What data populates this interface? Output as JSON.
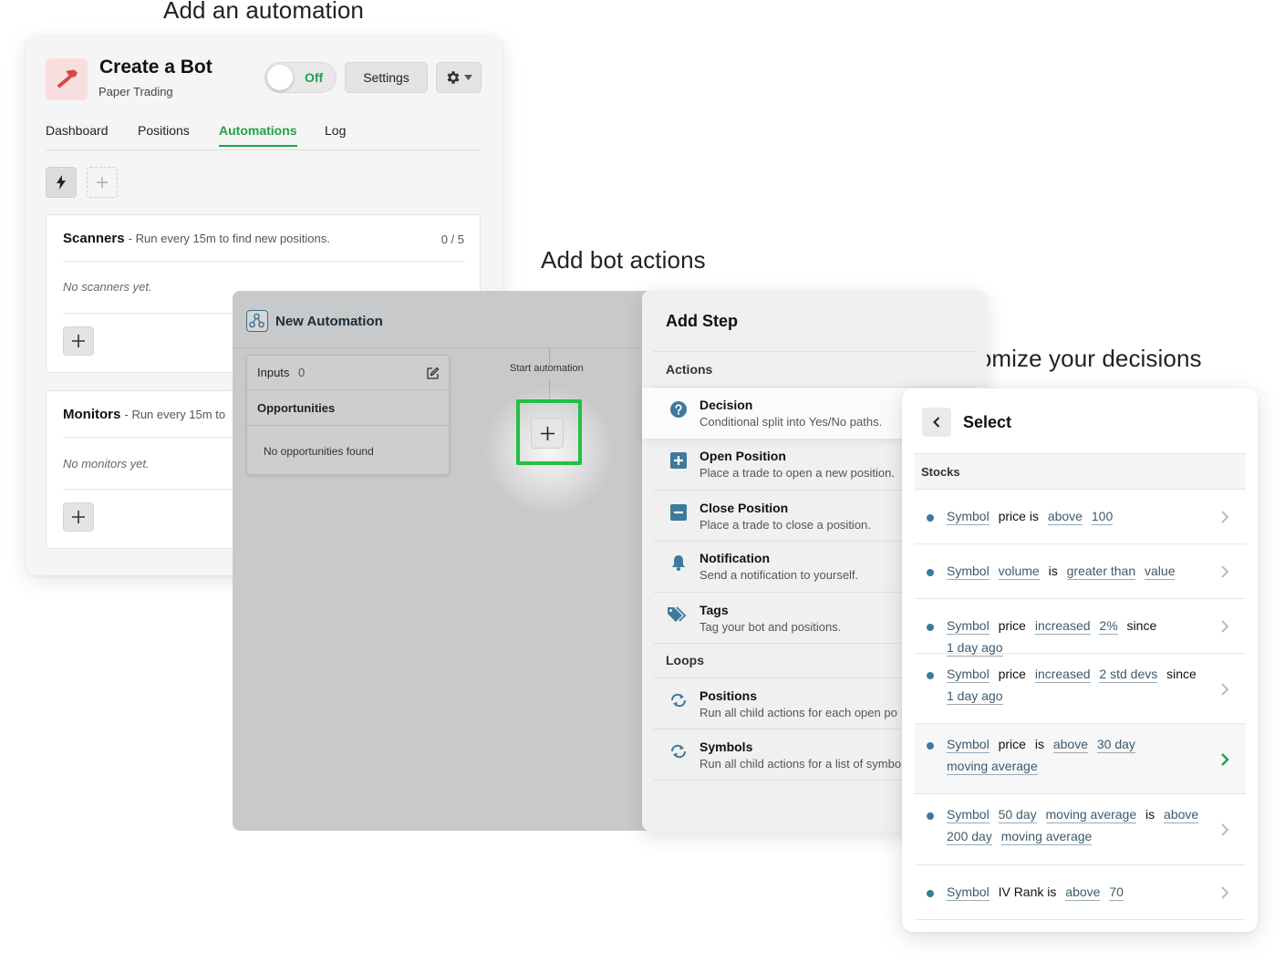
{
  "headings": {
    "automation": "Add an automation",
    "actions": "Add bot actions",
    "decisions": "Customize your decisions"
  },
  "bot": {
    "title": "Create a Bot",
    "subtitle": "Paper Trading",
    "toggle_label": "Off",
    "settings_label": "Settings",
    "tabs": [
      "Dashboard",
      "Positions",
      "Automations",
      "Log"
    ],
    "active_tab": "Automations",
    "scanners": {
      "title": "Scanners",
      "description": "- Run every 15m to find new positions.",
      "count": "0 / 5",
      "empty": "No scanners yet."
    },
    "monitors": {
      "title": "Monitors",
      "description": "- Run every 15m to",
      "empty": "No monitors yet."
    }
  },
  "automation": {
    "title": "New Automation",
    "inputs_label": "Inputs",
    "inputs_count": "0",
    "opportunities_label": "Opportunities",
    "opportunities_empty": "No opportunities found",
    "start_label": "Start automation"
  },
  "add_step": {
    "title": "Add Step",
    "actions_label": "Actions",
    "loops_label": "Loops",
    "actions": [
      {
        "name": "Decision",
        "desc": "Conditional split into Yes/No paths.",
        "icon": "question-circle-icon"
      },
      {
        "name": "Open Position",
        "desc": "Place a trade to open a new position.",
        "icon": "plus-square-icon"
      },
      {
        "name": "Close Position",
        "desc": "Place a trade to close a position.",
        "icon": "minus-square-icon"
      },
      {
        "name": "Notification",
        "desc": "Send a notification to yourself.",
        "icon": "bell-icon"
      },
      {
        "name": "Tags",
        "desc": "Tag your bot and positions.",
        "icon": "tags-icon"
      }
    ],
    "loops": [
      {
        "name": "Positions",
        "desc": "Run all child actions for each open po",
        "icon": "loop-icon"
      },
      {
        "name": "Symbols",
        "desc": "Run all child actions for a list of symbo",
        "icon": "loop-icon"
      }
    ]
  },
  "select": {
    "title": "Select",
    "section": "Stocks",
    "conditions": [
      [
        {
          "t": "Symbol",
          "u": true
        },
        {
          "t": "price is"
        },
        {
          "t": "above",
          "u": true
        },
        {
          "t": "100",
          "u": true
        }
      ],
      [
        {
          "t": "Symbol",
          "u": true
        },
        {
          "t": "volume",
          "u": true
        },
        {
          "t": "is"
        },
        {
          "t": "greater than",
          "u": true
        },
        {
          "t": "value",
          "u": true
        }
      ],
      [
        {
          "t": "Symbol",
          "u": true
        },
        {
          "t": "price"
        },
        {
          "t": "increased",
          "u": true
        },
        {
          "t": "2%",
          "u": true
        },
        {
          "t": "since"
        },
        {
          "t": "1 day ago",
          "u": true
        }
      ],
      [
        {
          "t": "Symbol",
          "u": true
        },
        {
          "t": "price"
        },
        {
          "t": "increased",
          "u": true
        },
        {
          "t": "2 std devs",
          "u": true
        },
        {
          "t": "since"
        },
        {
          "t": "1 day ago",
          "u": true
        }
      ],
      [
        {
          "t": "Symbol",
          "u": true
        },
        {
          "t": "price"
        },
        {
          "t": "is"
        },
        {
          "t": "above",
          "u": true
        },
        {
          "t": "30 day",
          "u": true
        },
        {
          "t": "moving average",
          "u": true
        }
      ],
      [
        {
          "t": "Symbol",
          "u": true
        },
        {
          "t": "50 day",
          "u": true
        },
        {
          "t": "moving average",
          "u": true
        },
        {
          "t": "is"
        },
        {
          "t": "above",
          "u": true
        },
        {
          "t": "200 day",
          "u": true
        },
        {
          "t": "moving average",
          "u": true
        }
      ],
      [
        {
          "t": "Symbol",
          "u": true
        },
        {
          "t": "IV Rank is"
        },
        {
          "t": "above",
          "u": true
        },
        {
          "t": "70",
          "u": true
        }
      ]
    ],
    "highlighted_index": 4,
    "colors": {
      "accent": "#1fa34a",
      "dot": "#3e7a9b"
    }
  }
}
